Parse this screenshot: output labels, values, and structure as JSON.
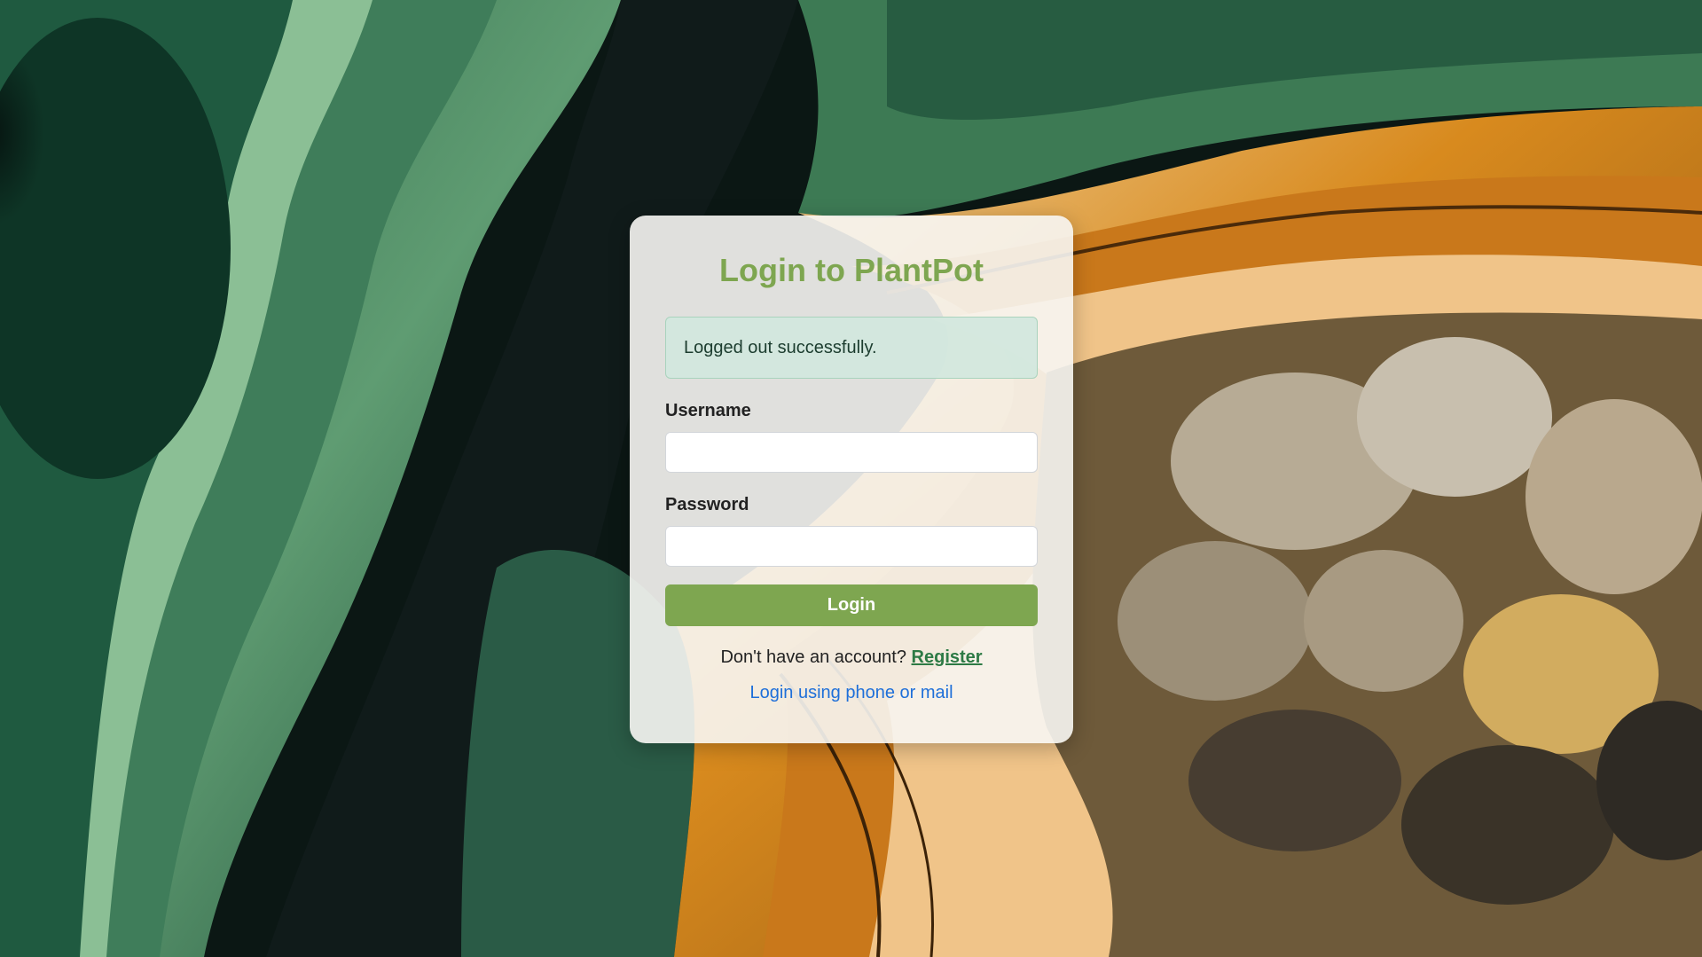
{
  "page": {
    "title": "Login to PlantPot"
  },
  "alert": {
    "message": "Logged out successfully."
  },
  "form": {
    "username_label": "Username",
    "username_value": "",
    "password_label": "Password",
    "password_value": "",
    "submit_label": "Login"
  },
  "footer": {
    "register_prompt": "Don't have an account?",
    "register_link": "Register",
    "alt_login_link": "Login using phone or mail"
  },
  "colors": {
    "accent": "#7ea650",
    "alert_bg": "#d1e7dd",
    "link_blue": "#1e6fd9",
    "register_green": "#2d7a45"
  }
}
